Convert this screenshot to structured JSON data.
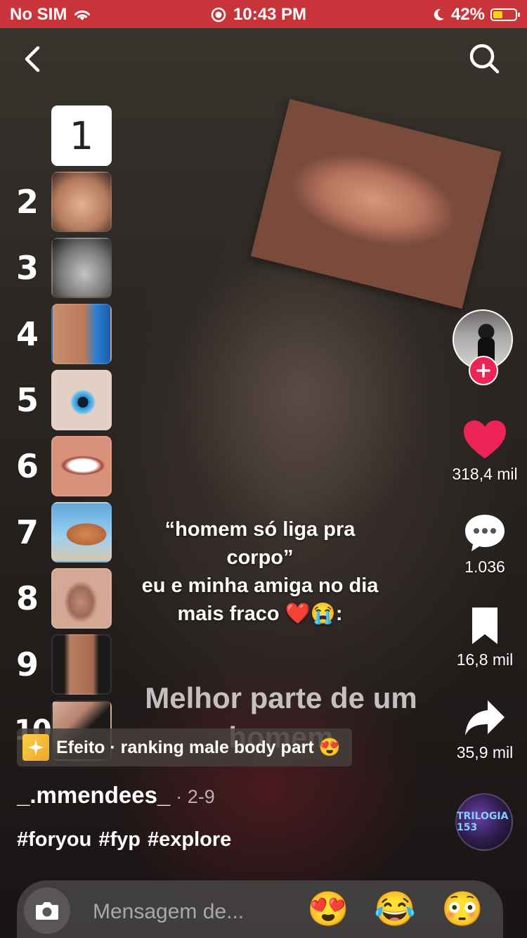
{
  "status_bar": {
    "carrier": "No SIM",
    "time": "10:43 PM",
    "battery": "42%",
    "battery_level": 0.42
  },
  "nav": {
    "back_icon": "chevron-left-icon",
    "search_icon": "search-icon"
  },
  "ranking": {
    "items": [
      {
        "number": "",
        "thumb_label": "1"
      },
      {
        "number": "2"
      },
      {
        "number": "3"
      },
      {
        "number": "4"
      },
      {
        "number": "5"
      },
      {
        "number": "6"
      },
      {
        "number": "7"
      },
      {
        "number": "8"
      },
      {
        "number": "9"
      },
      {
        "number": "10"
      }
    ]
  },
  "caption": {
    "line1": "“homem só liga pra",
    "line2": "corpo”",
    "line3": "eu e minha amiga no dia",
    "line4": "mais fraco ❤️😭:"
  },
  "watermark": {
    "line1": "Melhor parte de um",
    "line2": "homem"
  },
  "effect": {
    "label": "Efeito · ranking male body part 😍"
  },
  "post": {
    "username": "_.mmendees_",
    "date": "· 2-9",
    "hashtags": [
      "#foryou",
      "#fyp",
      "#explore"
    ]
  },
  "actions": {
    "likes": "318,4 mil",
    "comments": "1.036",
    "saves": "16,8 mil",
    "shares": "35,9 mil"
  },
  "music": {
    "disc_text": "TRILOGIA 153"
  },
  "message_bar": {
    "placeholder": "Mensagem de...",
    "emojis": [
      "😍",
      "😂",
      "😳"
    ]
  },
  "colors": {
    "status_bar_bg": "#c9343b",
    "like_red": "#ee2456",
    "battery_yellow": "#f6d21b"
  }
}
